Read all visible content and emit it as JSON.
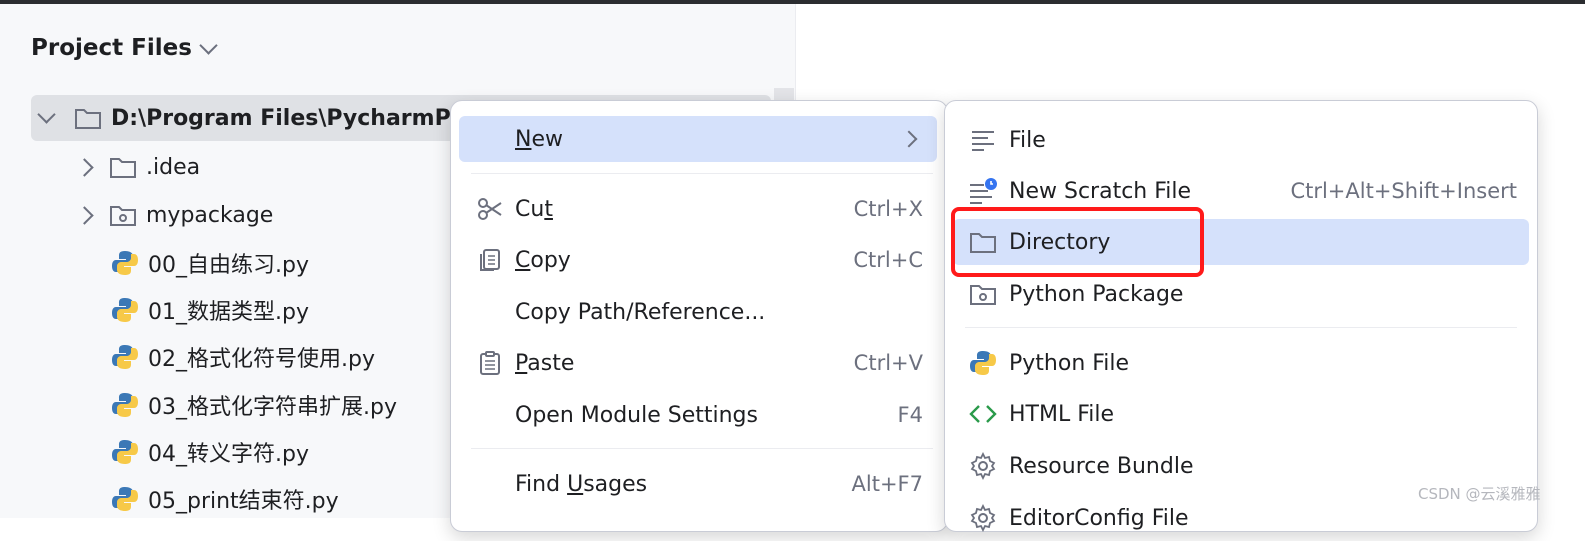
{
  "pane": {
    "title": "Project Files"
  },
  "tree": {
    "root": "D:\\Program Files\\PycharmPr",
    "items": [
      {
        "label": ".idea",
        "icon": "folder-icon"
      },
      {
        "label": "mypackage",
        "icon": "package-icon"
      },
      {
        "label": "00_自由练习.py",
        "icon": "python-icon"
      },
      {
        "label": "01_数据类型.py",
        "icon": "python-icon"
      },
      {
        "label": "02_格式化符号使用.py",
        "icon": "python-icon"
      },
      {
        "label": "03_格式化字符串扩展.py",
        "icon": "python-icon"
      },
      {
        "label": "04_转义字符.py",
        "icon": "python-icon"
      },
      {
        "label": "05_print结束符.py",
        "icon": "python-icon"
      }
    ]
  },
  "menu": {
    "new": {
      "pre": "",
      "u": "N",
      "post": "ew"
    },
    "cut": {
      "pre": "Cu",
      "u": "t",
      "post": "",
      "shortcut": "Ctrl+X"
    },
    "copy": {
      "pre": "",
      "u": "C",
      "post": "opy",
      "shortcut": "Ctrl+C"
    },
    "copy_path": "Copy Path/Reference...",
    "paste": {
      "pre": "",
      "u": "P",
      "post": "aste",
      "shortcut": "Ctrl+V"
    },
    "module_settings": {
      "label": "Open Module Settings",
      "shortcut": "F4"
    },
    "find_usages": {
      "pre": "Find ",
      "u": "U",
      "post": "sages",
      "shortcut": "Alt+F7"
    }
  },
  "submenu": {
    "file": "File",
    "scratch": {
      "label": "New Scratch File",
      "shortcut": "Ctrl+Alt+Shift+Insert"
    },
    "directory": "Directory",
    "python_package": "Python Package",
    "python_file": "Python File",
    "html_file": "HTML File",
    "resource_bundle": "Resource Bundle",
    "editor_config": "EditorConfig File"
  },
  "watermark": "CSDN @云溪雅雅",
  "colors": {
    "highlight": "#d5e1fb",
    "selected_row": "#dfe1e5",
    "annotation_box": "#ff1a1a",
    "python_blue": "#3b78b6",
    "python_yellow": "#f7c948"
  }
}
